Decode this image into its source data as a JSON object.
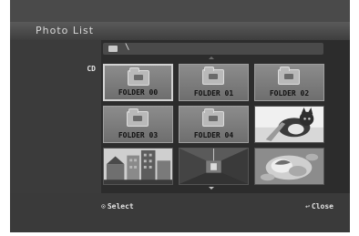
{
  "window": {
    "title": "Photo List"
  },
  "location": {
    "path": "\\"
  },
  "sidebar": {
    "source_label": "CD"
  },
  "grid": {
    "items": [
      {
        "type": "folder",
        "label": "FOLDER 00",
        "selected": true
      },
      {
        "type": "folder",
        "label": "FOLDER 01",
        "selected": false
      },
      {
        "type": "folder",
        "label": "FOLDER 02",
        "selected": false
      },
      {
        "type": "folder",
        "label": "FOLDER 03",
        "selected": false
      },
      {
        "type": "folder",
        "label": "FOLDER 04",
        "selected": false
      },
      {
        "type": "photo",
        "subject": "cat"
      },
      {
        "type": "photo",
        "subject": "buildings"
      },
      {
        "type": "photo",
        "subject": "corridor"
      },
      {
        "type": "photo",
        "subject": "shells"
      }
    ]
  },
  "footer": {
    "select_icon": "select-icon",
    "select_label": "Select",
    "close_icon": "return-icon",
    "close_label": "Close"
  },
  "colors": {
    "background": "#1f1f1f",
    "sidebar": "#3b3b3b",
    "tile": "#8c8c8c",
    "text": "#e4e4e4"
  }
}
